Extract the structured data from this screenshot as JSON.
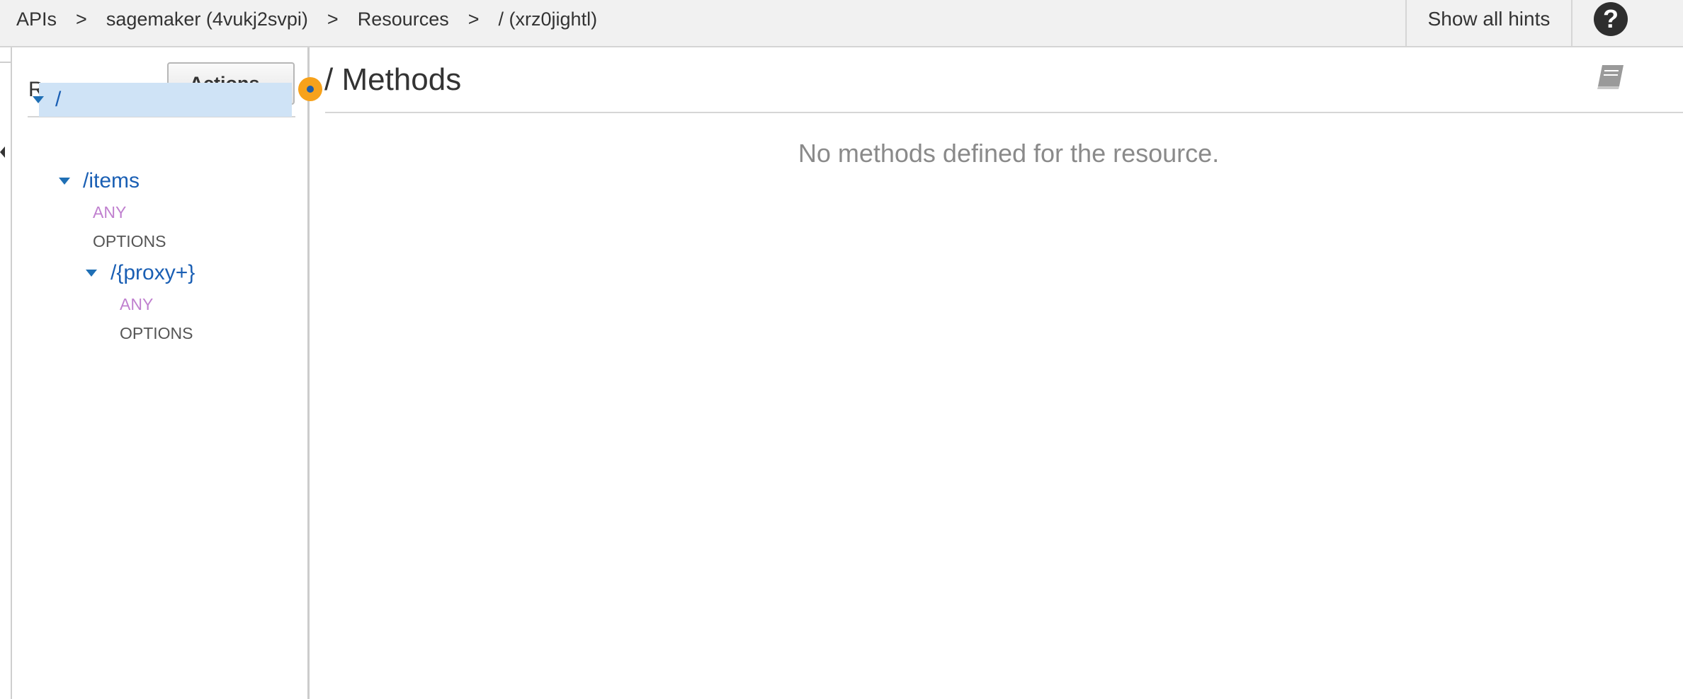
{
  "breadcrumb": {
    "items": [
      "APIs",
      "sagemaker (4vukj2svpi)",
      "Resources",
      "/ (xrz0jightl)"
    ],
    "separator": ">"
  },
  "header": {
    "hints_label": "Show all hints",
    "help_label": "?"
  },
  "sidebar": {
    "title": "Resources",
    "actions_label": "Actions",
    "tree": {
      "root": "/",
      "items": "/items",
      "items_any": "ANY",
      "items_options": "OPTIONS",
      "proxy": "/{proxy+}",
      "proxy_any": "ANY",
      "proxy_options": "OPTIONS"
    }
  },
  "main": {
    "title": "/ Methods",
    "empty_message": "No methods defined for the resource."
  },
  "icons": {
    "help": "help-circle-icon",
    "docs": "book-icon",
    "collapse": "collapse-left-icon",
    "resize": "resize-handle-icon",
    "expand": "caret-down-icon"
  },
  "colors": {
    "link_blue": "#1a5fb4",
    "selected_row": "#cfe3f6",
    "method_any": "#c080cf",
    "method_options": "#555555",
    "resize_handle": "#f7a21b",
    "topbar": "#f1f1f1"
  }
}
